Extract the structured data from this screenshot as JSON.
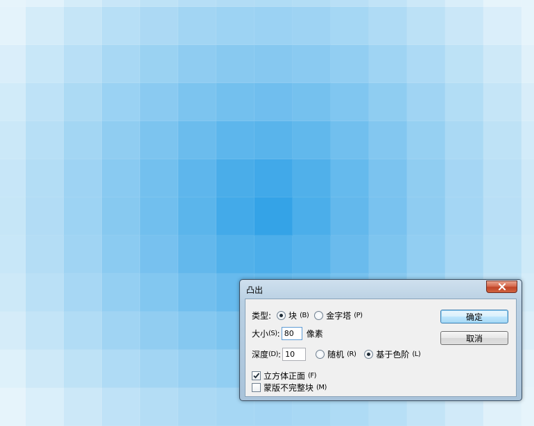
{
  "colors": {
    "tile_light": "#e6f4fb",
    "tile_dark": "#2b9fe6",
    "dialog_frame": "#b9d0e3",
    "close_red": "#c04428"
  },
  "dialog": {
    "title": "凸出",
    "close_icon": "close-x-icon",
    "type": {
      "label": "类型:",
      "options": [
        {
          "label": "块",
          "hotkey": "(B)",
          "selected": true
        },
        {
          "label": "金字塔",
          "hotkey": "(P)",
          "selected": false
        }
      ]
    },
    "size": {
      "label": "大小",
      "hotkey": "(S)",
      "colon": ":",
      "value": "80",
      "unit": "像素"
    },
    "depth": {
      "label": "深度",
      "hotkey": "(D)",
      "colon": ":",
      "value": "10",
      "options": [
        {
          "label": "随机",
          "hotkey": "(R)",
          "selected": false
        },
        {
          "label": "基于色阶",
          "hotkey": "(L)",
          "selected": true
        }
      ]
    },
    "checkboxes": [
      {
        "label": "立方体正面",
        "hotkey": "(F)",
        "checked": true
      },
      {
        "label": "蒙版不完整块",
        "hotkey": "(M)",
        "checked": false
      }
    ],
    "ok_label": "确定",
    "cancel_label": "取消"
  }
}
